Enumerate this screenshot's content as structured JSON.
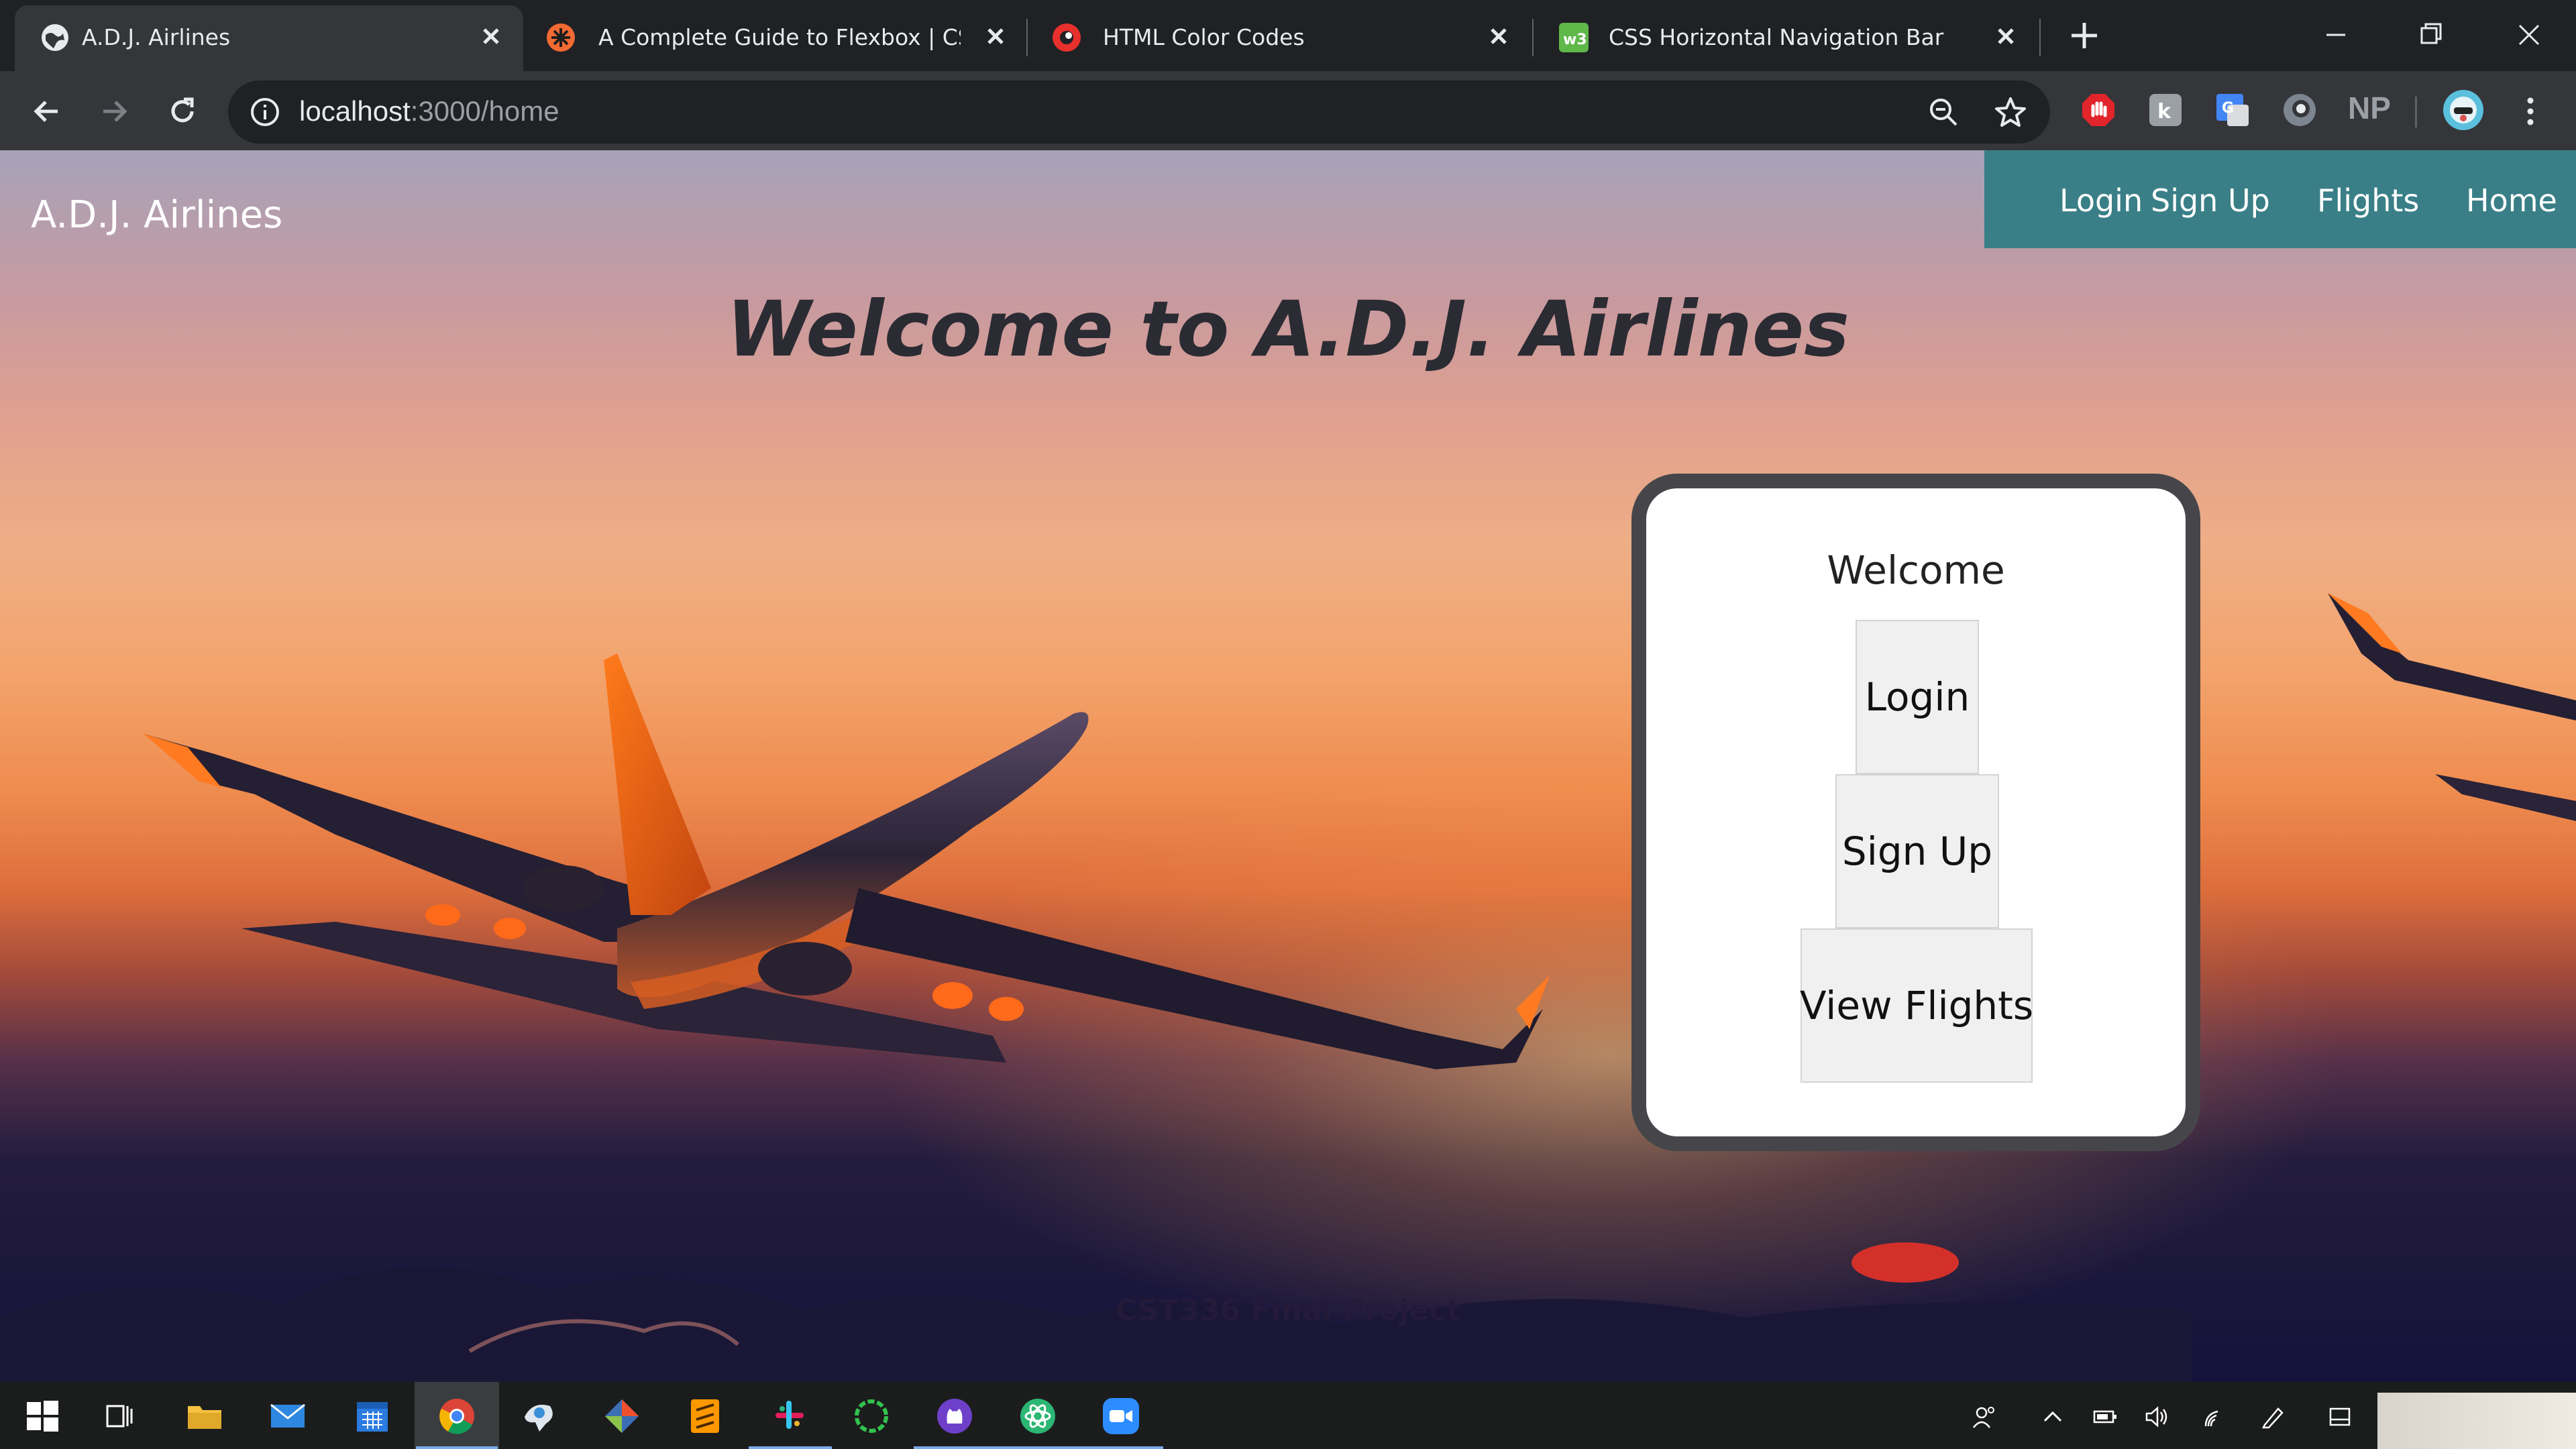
{
  "browser": {
    "tabs": [
      {
        "title": "A.D.J. Airlines",
        "active": true,
        "icon": "globe-icon"
      },
      {
        "title": "A Complete Guide to Flexbox | CSS-Tricks",
        "active": false,
        "icon": "css-tricks-icon"
      },
      {
        "title": "HTML Color Codes",
        "active": false,
        "icon": "color-codes-icon"
      },
      {
        "title": "CSS Horizontal Navigation Bar",
        "active": false,
        "icon": "w3schools-icon"
      }
    ],
    "url_host": "localhost",
    "url_path": ":3000/home",
    "extensions": [
      "adblock-icon",
      "extension-icon",
      "translate-icon",
      "extension-icon",
      "NP",
      "profile-avatar"
    ]
  },
  "site": {
    "brand": "A.D.J. Airlines",
    "nav": [
      "Login",
      "Sign Up",
      "Flights",
      "Home"
    ],
    "hero_title": "Welcome to A.D.J. Airlines",
    "card": {
      "title": "Welcome",
      "buttons": [
        "Login",
        "Sign Up",
        "View Flights"
      ]
    },
    "footer": "CST336 Final Project"
  },
  "taskbar": {
    "apps": [
      "start",
      "task-view",
      "file-explorer",
      "mail",
      "calendar",
      "chrome",
      "paint-3d",
      "gitkraken",
      "sublime-text",
      "slack",
      "spinner-app",
      "github-desktop",
      "electron-app",
      "zoom"
    ]
  },
  "colors": {
    "nav_bg": "#3a7f87",
    "tab_active": "#35363a",
    "chrome_bg": "#202124",
    "card_border": "#46464a"
  }
}
